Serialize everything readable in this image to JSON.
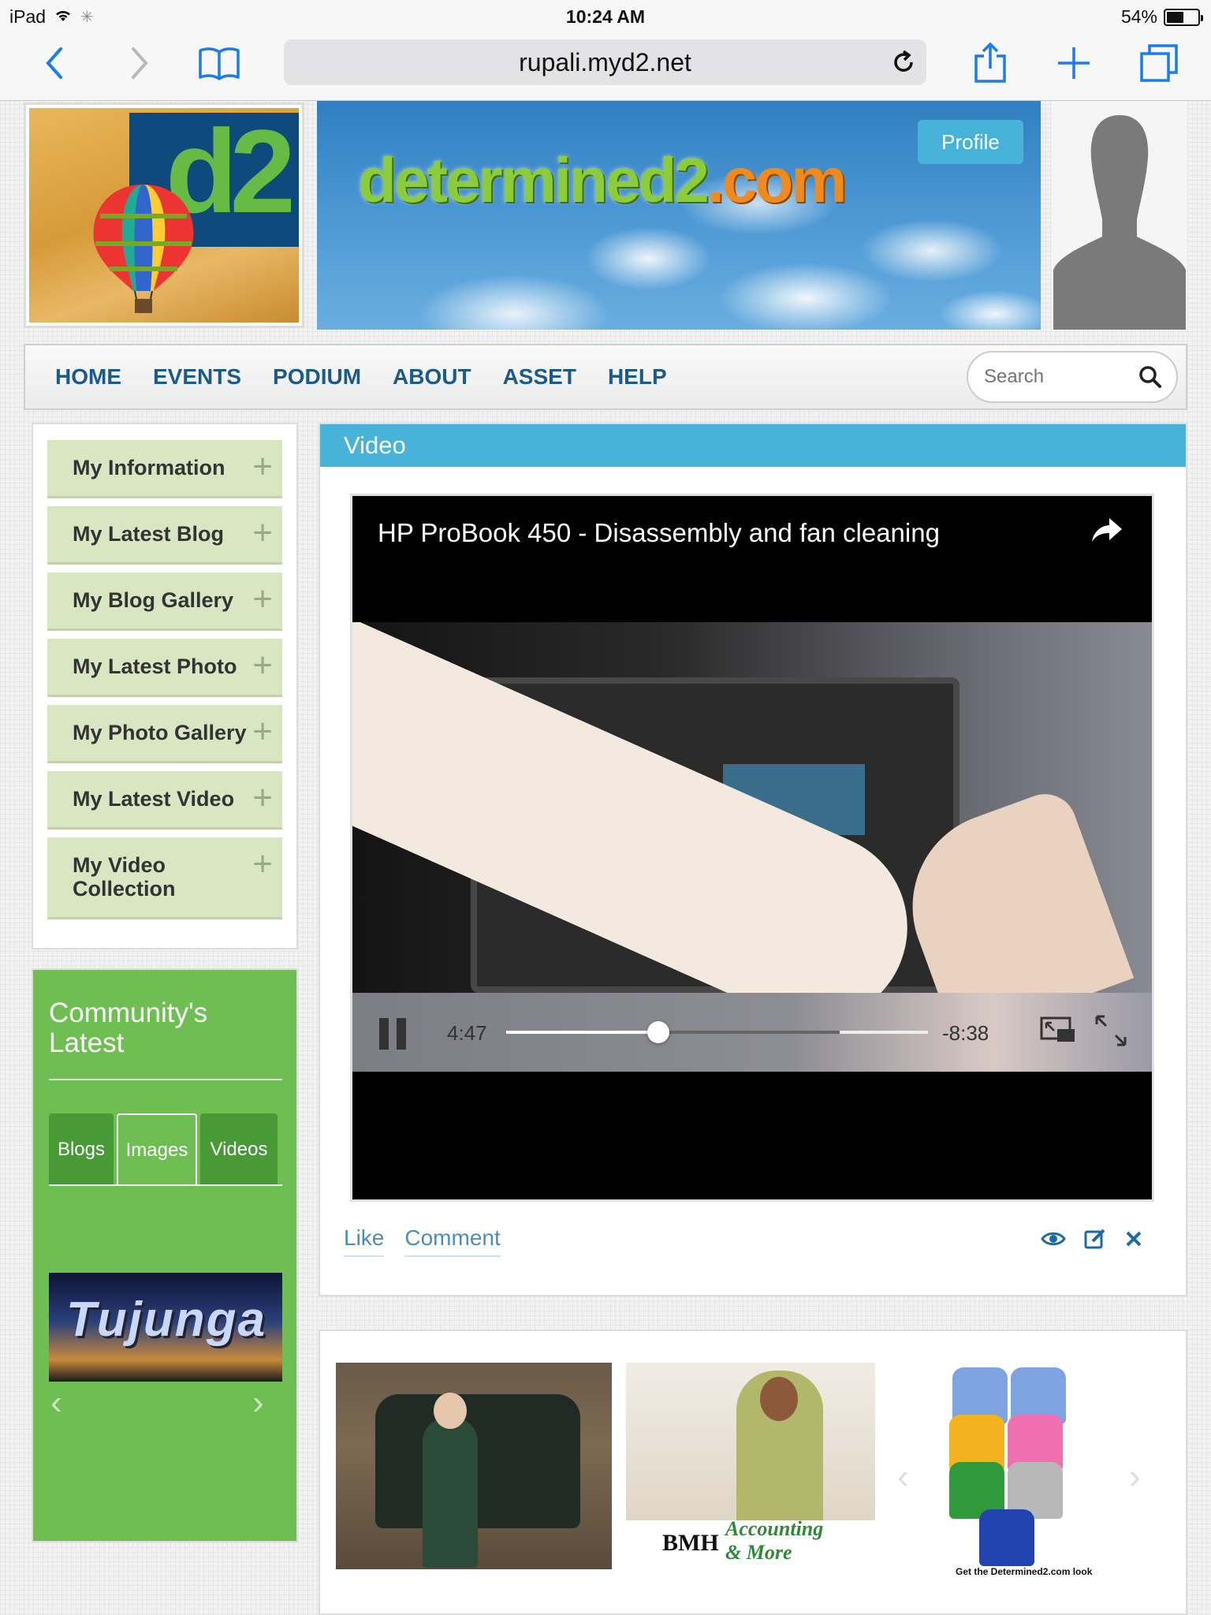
{
  "status_bar": {
    "device": "iPad",
    "time": "10:24 AM",
    "battery_percent": "54%",
    "battery_level": 0.54
  },
  "browser": {
    "url": "rupali.myd2.net"
  },
  "header": {
    "logo_text": "d2",
    "banner_logo_main": "determined2",
    "banner_logo_suffix": ".com",
    "profile_button": "Profile"
  },
  "nav": {
    "items": [
      "HOME",
      "EVENTS",
      "PODIUM",
      "ABOUT",
      "ASSET",
      "HELP"
    ],
    "search_placeholder": "Search"
  },
  "sidebar": {
    "items": [
      {
        "label": "My Information"
      },
      {
        "label": "My Latest Blog"
      },
      {
        "label": "My Blog Gallery"
      },
      {
        "label": "My Latest Photo"
      },
      {
        "label": "My Photo Gallery"
      },
      {
        "label": "My Latest Video"
      },
      {
        "label": "My Video Collection"
      }
    ],
    "plus_symbol": "+"
  },
  "community": {
    "title": "Community's Latest",
    "tabs": [
      "Blogs",
      "Images",
      "Videos"
    ],
    "active_tab": "Images",
    "image_title": "Tujunga",
    "prev_symbol": "‹",
    "next_symbol": "›"
  },
  "video": {
    "section_title": "Video",
    "title": "HP ProBook 450 - Disassembly and fan cleaning",
    "current_time": "4:47",
    "remaining_time": "-8:38",
    "progress_fraction": 0.36,
    "buffered_fraction": 0.79,
    "like_label": "Like",
    "comment_label": "Comment"
  },
  "ads": {
    "bmh_brand": "BMH",
    "bmh_tagline_1": "Accounting",
    "bmh_tagline_2": "& More",
    "shirts_caption": "Get the Determined2.com look",
    "shirt_colors": [
      "#7da4e0",
      "#7da4e0",
      "#f2b21e",
      "#f06fb0",
      "#2e9a3c",
      "#b8b8b8",
      "#2244b0"
    ],
    "prev_symbol": "‹",
    "next_symbol": "›"
  },
  "colors": {
    "accent_blue": "#48b3d8",
    "nav_text": "#1a5a8c",
    "menu_bg": "#d8e6c2",
    "community_green": "#6fbe54"
  }
}
